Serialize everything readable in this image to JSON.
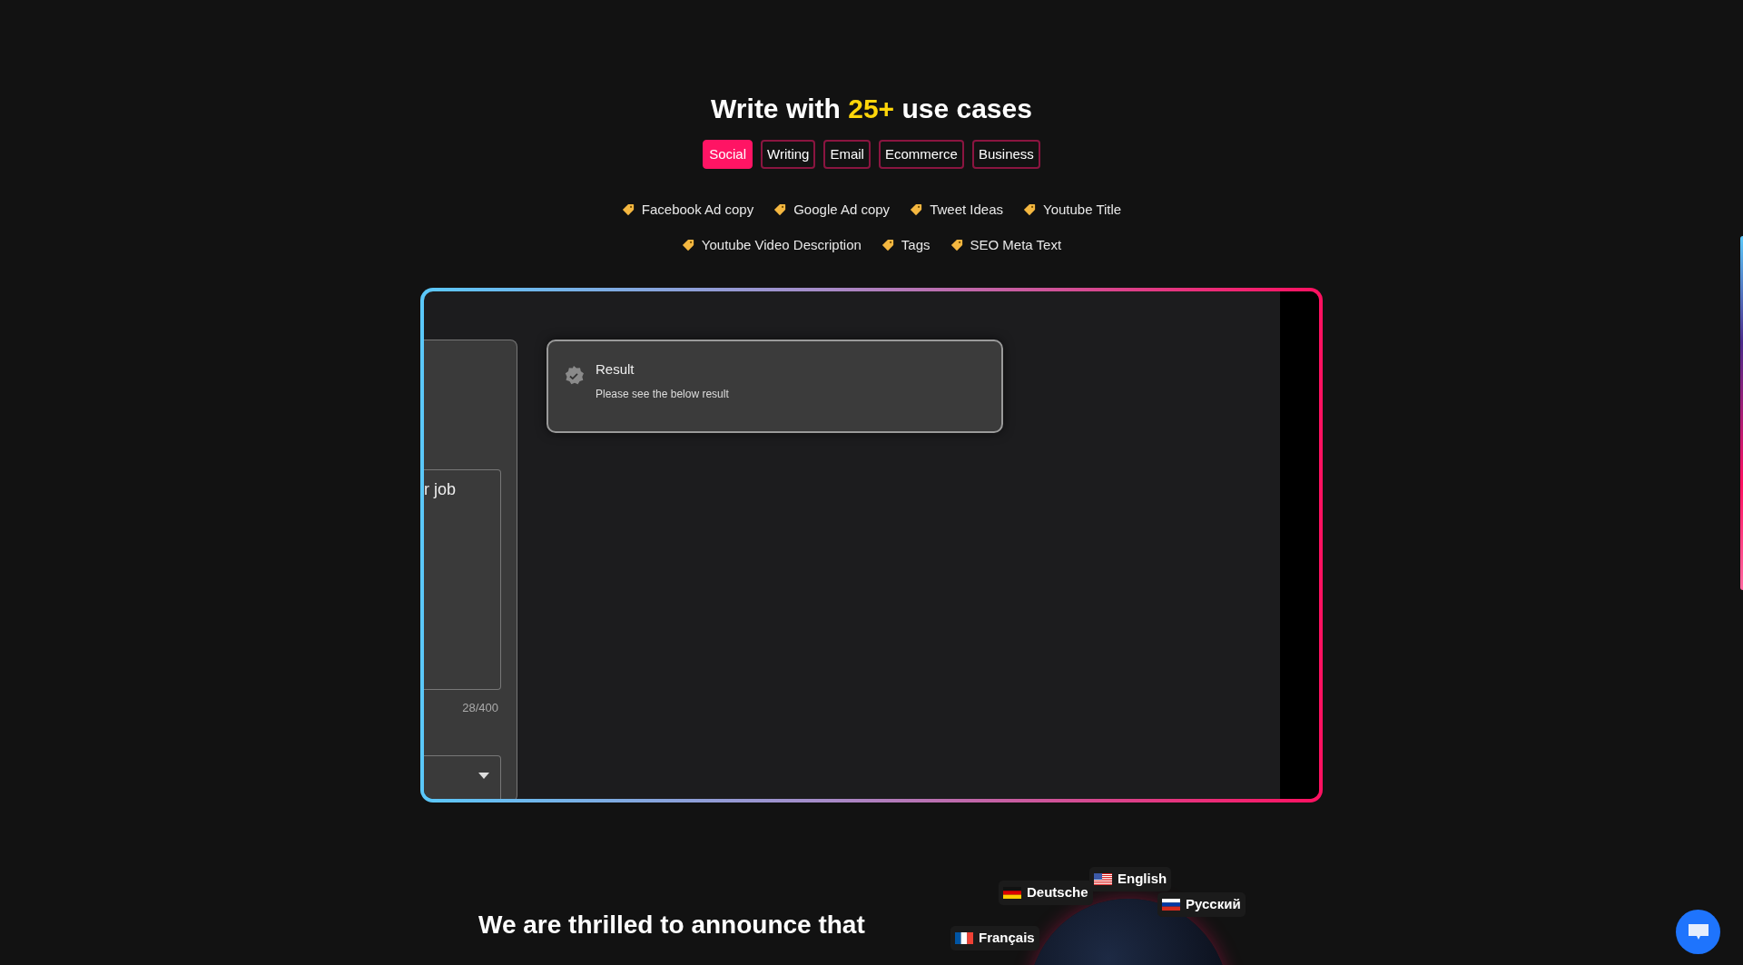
{
  "heading": {
    "before": "Write with ",
    "highlight": "25+",
    "after": " use cases"
  },
  "tabs": [
    {
      "label": "Social",
      "selected": true
    },
    {
      "label": "Writing",
      "selected": false
    },
    {
      "label": "Email",
      "selected": false
    },
    {
      "label": "Ecommerce",
      "selected": false
    },
    {
      "label": "Business",
      "selected": false
    }
  ],
  "use_case_rows": [
    [
      "Facebook Ad copy",
      "Google Ad copy",
      "Tweet Ideas",
      "Youtube Title"
    ],
    [
      "Youtube Video Description",
      "Tags",
      "SEO Meta Text"
    ]
  ],
  "demo": {
    "input_value": "r job",
    "counter": "28/400",
    "result": {
      "title": "Result",
      "subtitle": "Please see the below result"
    }
  },
  "announcement": {
    "lines": [
      "We are thrilled to announce that"
    ]
  },
  "languages": [
    {
      "label": "English",
      "kind": "us"
    },
    {
      "label": "Deutsche",
      "kind": "de"
    },
    {
      "label": "Русский",
      "kind": "ru"
    },
    {
      "label": "Français",
      "kind": "fr"
    }
  ]
}
